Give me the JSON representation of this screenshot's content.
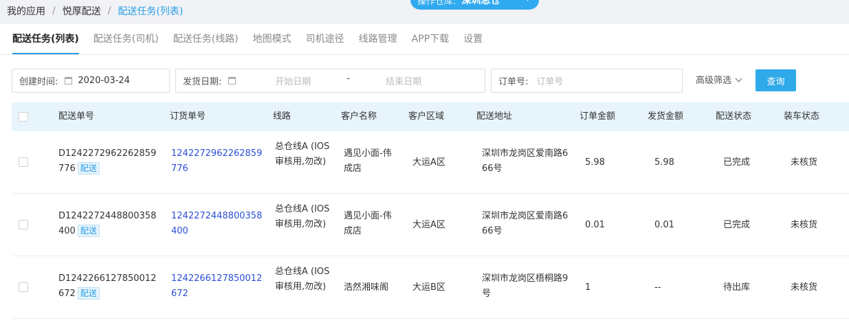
{
  "breadcrumb": {
    "items": [
      "我的应用",
      "悦厚配送",
      "配送任务(列表)"
    ],
    "separator": "/"
  },
  "warehouse": {
    "label": "操作仓库:",
    "value": "深圳总仓",
    "icon": "chevron-down-icon"
  },
  "tabs": [
    {
      "label": "配送任务(列表)",
      "active": true
    },
    {
      "label": "配送任务(司机)",
      "active": false
    },
    {
      "label": "配送任务(线路)",
      "active": false
    },
    {
      "label": "地图模式",
      "active": false
    },
    {
      "label": "司机途径",
      "active": false
    },
    {
      "label": "线路管理",
      "active": false
    },
    {
      "label": "APP下载",
      "active": false
    },
    {
      "label": "设置",
      "active": false
    }
  ],
  "filters": {
    "created": {
      "label": "创建时间:",
      "value": "2020-03-24",
      "icon": "calendar-icon"
    },
    "ship_date": {
      "label": "发货日期:",
      "start_placeholder": "开始日期",
      "range_sep": "-",
      "end_placeholder": "结束日期",
      "icon": "calendar-icon"
    },
    "order_no": {
      "label": "订单号:",
      "placeholder": "订单号"
    },
    "advanced": {
      "label": "高级筛选",
      "icon": "chevron-down-icon"
    },
    "query_button": "查询"
  },
  "table": {
    "columns": [
      "配送单号",
      "订货单号",
      "线路",
      "客户名称",
      "客户区域",
      "配送地址",
      "订单金额",
      "发货金额",
      "配送状态",
      "装车状态"
    ],
    "rows": [
      {
        "delivery_no": "D1242272962262859776",
        "delivery_tag": "配送",
        "order_no": "1242272962262859776",
        "route": "总仓线A (IOS审核用,勿改)",
        "customer": "遇见小面-伟成店",
        "region": "大运A区",
        "address": "深圳市龙岗区爱南路666号",
        "order_amount": "5.98",
        "ship_amount": "5.98",
        "delivery_status": "已完成",
        "load_status": "未核货"
      },
      {
        "delivery_no": "D1242272448800358400",
        "delivery_tag": "配送",
        "order_no": "1242272448800358400",
        "route": "总仓线A (IOS审核用,勿改)",
        "customer": "遇见小面-伟成店",
        "region": "大运A区",
        "address": "深圳市龙岗区爱南路666号",
        "order_amount": "0.01",
        "ship_amount": "0.01",
        "delivery_status": "已完成",
        "load_status": "未核货"
      },
      {
        "delivery_no": "D1242266127850012672",
        "delivery_tag": "配送",
        "order_no": "1242266127850012672",
        "route": "总仓线A (IOS审核用,勿改)",
        "customer": "浩然湘味阁",
        "region": "大运B区",
        "address": "深圳市龙岗区梧桐路9号",
        "order_amount": "1",
        "ship_amount": "--",
        "delivery_status": "待出库",
        "load_status": "未核货"
      }
    ]
  },
  "colors": {
    "accent": "#2b9fe8",
    "link": "#2b4fd6",
    "header_bg": "#e7f4fb"
  }
}
